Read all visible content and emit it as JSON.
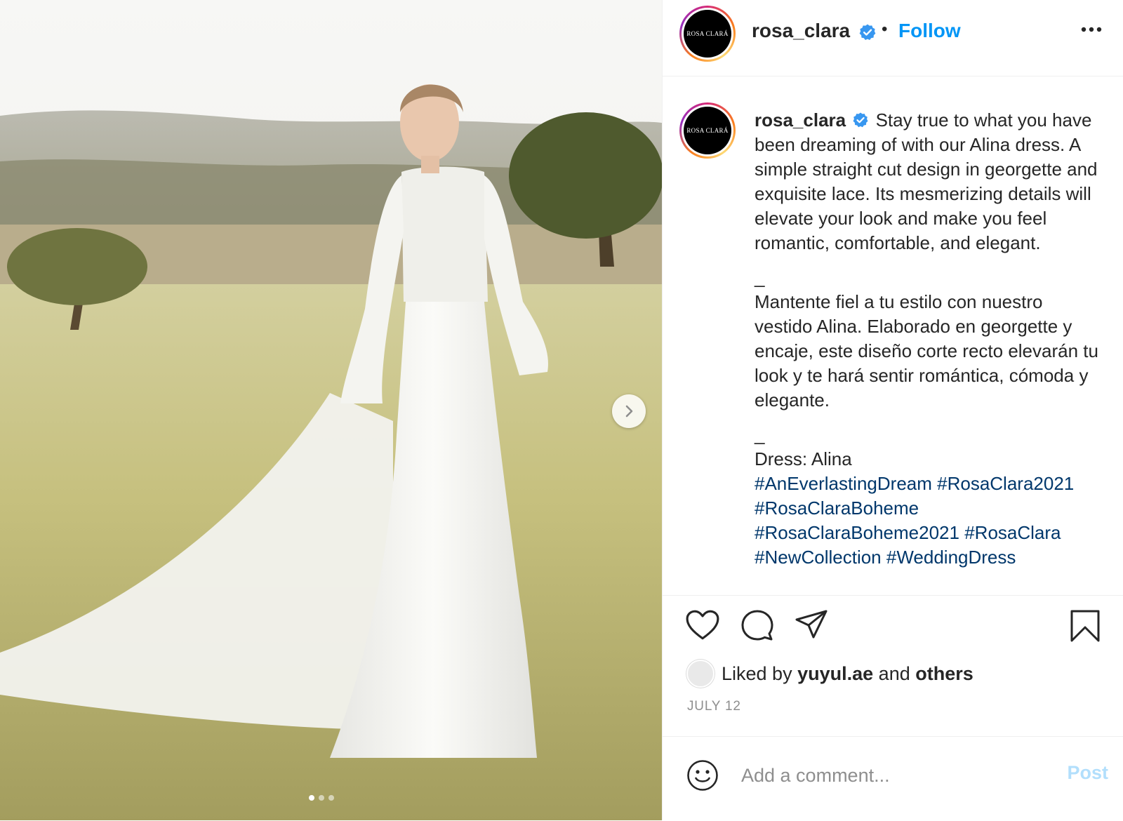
{
  "post": {
    "username": "rosa_clara",
    "avatar_text": "ROSA CLARÁ",
    "verified_icon": "verified-badge-icon",
    "separator": "•",
    "follow_label": "Follow",
    "more_icon": "more-options-icon",
    "carousel": {
      "active_index": 0,
      "total": 3,
      "next_icon": "chevron-right-icon"
    }
  },
  "caption": {
    "username": "rosa_clara",
    "line_en_1": "Stay true to what you have been dreaming of with our Alina dress. A simple straight cut design in georgette and exquisite lace. Its mesmerizing details will elevate your look and make you feel romantic, comfortable, and elegant.",
    "divider_1": "_",
    "line_es": "Mantente fiel a tu estilo con nuestro vestido Alina. Elaborado en georgette y encaje, este diseño corte recto elevarán tu look y te hará sentir romántica, cómoda y elegante.",
    "divider_2": "_",
    "dress_line": "Dress: Alina",
    "hashtags": [
      "#AnEverlastingDream",
      "#RosaClara2021",
      "#RosaClaraBoheme",
      "#RosaClaraBoheme2021",
      "#RosaClara",
      "#NewCollection",
      "#WeddingDress"
    ]
  },
  "actions": {
    "like_icon": "heart-icon",
    "comment_icon": "comment-icon",
    "share_icon": "share-icon",
    "save_icon": "bookmark-icon"
  },
  "likes": {
    "prefix": "Liked by",
    "user": "yuyul.ae",
    "middle": "and",
    "others": "others"
  },
  "date": "JULY 12",
  "comment": {
    "emoji_icon": "emoji-icon",
    "placeholder": "Add a comment...",
    "post_label": "Post"
  },
  "colors": {
    "link_blue": "#0095f6",
    "hashtag": "#00376b",
    "post_disabled": "#b2dffc",
    "verified": "#3897f0"
  }
}
